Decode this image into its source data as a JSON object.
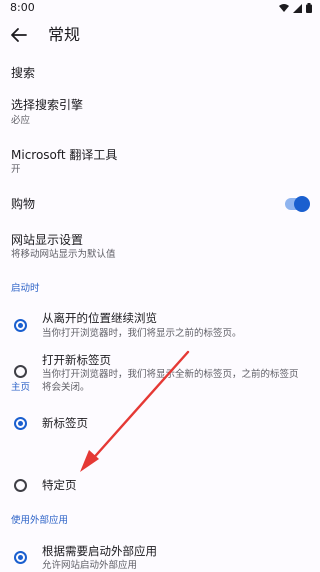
{
  "status": {
    "time": "8:00"
  },
  "appbar": {
    "title": "常规"
  },
  "items": {
    "search": {
      "label": "搜索"
    },
    "engine": {
      "label": "选择搜索引擎",
      "value": "必应"
    },
    "translator": {
      "label": "Microsoft 翻译工具",
      "value": "开"
    },
    "shopping": {
      "label": "购物",
      "enabled": true
    },
    "site": {
      "label": "网站显示设置",
      "value": "将移动网站显示为默认值"
    }
  },
  "startup": {
    "header": "启动时",
    "options": [
      {
        "label": "从离开的位置继续浏览",
        "desc": "当你打开浏览器时，我们将显示之前的标签页。",
        "selected": true
      },
      {
        "label": "打开新标签页",
        "desc": "当你打开浏览器时，我们将显示全新的标签页，之前的标签页将会关闭。",
        "selected": false
      }
    ]
  },
  "home": {
    "header": "主页",
    "options": [
      {
        "label": "新标签页",
        "selected": true
      },
      {
        "label": "特定页",
        "selected": false
      }
    ]
  },
  "external": {
    "header": "使用外部应用",
    "options": [
      {
        "label": "根据需要启动外部应用",
        "desc": "允许网站启动外部应用",
        "selected": true
      }
    ]
  },
  "colors": {
    "accent": "#1a5fcf",
    "annotation_arrow": "#e53935"
  }
}
